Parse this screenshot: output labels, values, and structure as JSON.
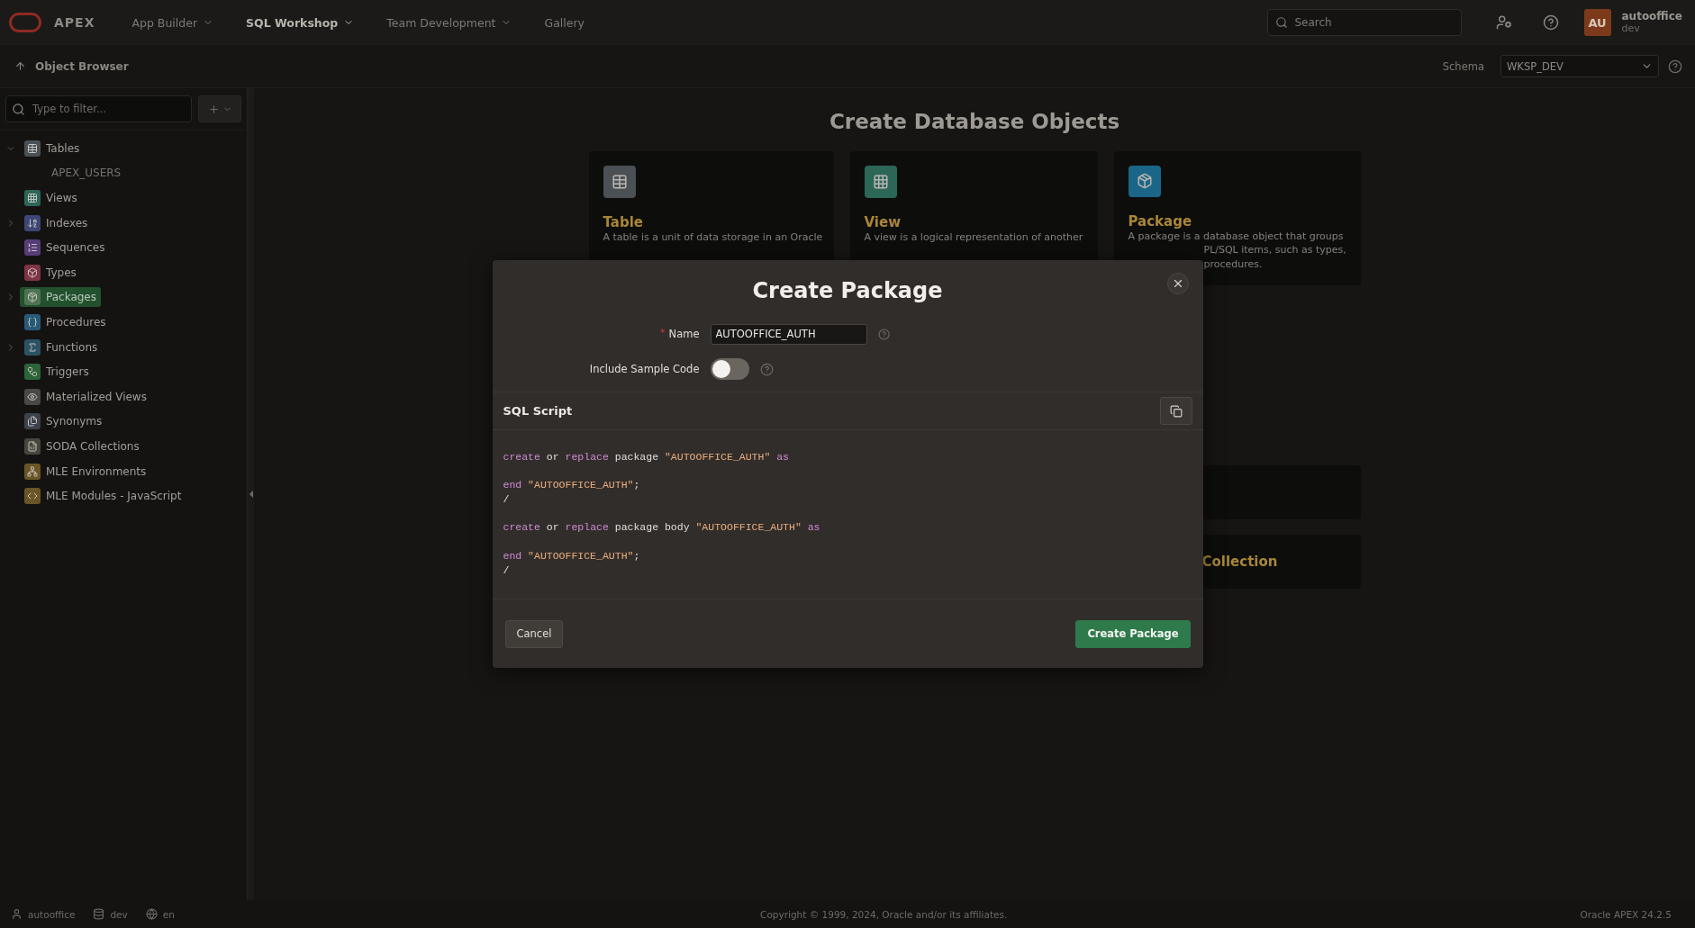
{
  "top_bar": {
    "brand": "APEX",
    "nav": [
      {
        "label": "App Builder",
        "selected": false,
        "dropdown": true
      },
      {
        "label": "SQL Workshop",
        "selected": true,
        "dropdown": true
      },
      {
        "label": "Team Development",
        "selected": false,
        "dropdown": true
      },
      {
        "label": "Gallery",
        "selected": false,
        "dropdown": false
      }
    ],
    "search": {
      "placeholder": "Search"
    },
    "user": {
      "initials": "AU",
      "name": "autooffice",
      "workspace": "dev"
    }
  },
  "sub_bar": {
    "title": "Object Browser",
    "schema_label": "Schema",
    "schema_value": "WKSP_DEV"
  },
  "sidebar": {
    "filter": {
      "placeholder": "Type to filter..."
    },
    "items": [
      {
        "label": "Tables",
        "kind": "branch",
        "expanded": true,
        "selected": false,
        "color": "#4b5054",
        "children": [
          {
            "label": "APEX_USERS",
            "selected": false
          }
        ]
      },
      {
        "label": "Views",
        "kind": "leaf",
        "selected": false,
        "color": "#2c6657"
      },
      {
        "label": "Indexes",
        "kind": "branch",
        "expanded": false,
        "selected": false,
        "color": "#3d4677"
      },
      {
        "label": "Sequences",
        "kind": "leaf",
        "selected": false,
        "color": "#573d78"
      },
      {
        "label": "Types",
        "kind": "leaf",
        "selected": false,
        "color": "#7d3444"
      },
      {
        "label": "Packages",
        "kind": "branch",
        "expanded": false,
        "selected": true,
        "color": "#4f7352"
      },
      {
        "label": "Procedures",
        "kind": "leaf",
        "selected": false,
        "color": "#285a78"
      },
      {
        "label": "Functions",
        "kind": "branch",
        "expanded": false,
        "selected": false,
        "color": "#2b5264"
      },
      {
        "label": "Triggers",
        "kind": "leaf",
        "selected": false,
        "color": "#2b6438"
      },
      {
        "label": "Materialized Views",
        "kind": "leaf",
        "selected": false,
        "color": "#484848"
      },
      {
        "label": "Synonyms",
        "kind": "leaf",
        "selected": false,
        "color": "#3c414b"
      },
      {
        "label": "SODA Collections",
        "kind": "leaf",
        "selected": false,
        "color": "#47463c"
      },
      {
        "label": "MLE Environments",
        "kind": "leaf",
        "selected": false,
        "color": "#6a5526"
      },
      {
        "label": "MLE Modules - JavaScript",
        "kind": "leaf",
        "selected": false,
        "color": "#6a5526"
      }
    ]
  },
  "main": {
    "title": "Create Database Objects",
    "cards": [
      {
        "title": "Table",
        "color": "#4b5054",
        "lines": [
          "A table is a unit of data storage in an Oracle"
        ]
      },
      {
        "title": "View",
        "color": "#2c6657",
        "lines": [
          "A view is a logical representation of another"
        ]
      },
      {
        "title": "Package",
        "color": "#1b6688",
        "lines": [
          "A package is a database object that groups"
        ],
        "partial_lines": [
          "PL/SQL items, such as types,",
          "procedures."
        ]
      }
    ],
    "more_cards": [
      {
        "kind": "blank"
      },
      {
        "kind": "titled",
        "title": "Collection"
      }
    ]
  },
  "dialog": {
    "title": "Create Package",
    "fields": [
      {
        "label": "Name",
        "required_mark": "*",
        "kind": "text",
        "value": "AUTOOFFICE_AUTH"
      },
      {
        "label": "Include Sample Code",
        "kind": "switch",
        "on": false
      }
    ],
    "section_title": "SQL Script",
    "code": [
      {
        "kind": "code",
        "tokens": [
          {
            "kind": "keyword",
            "text": "create"
          },
          {
            "kind": "plain",
            "text": " or "
          },
          {
            "kind": "keyword",
            "text": "replace"
          },
          {
            "kind": "plain",
            "text": " package "
          },
          {
            "kind": "string",
            "text": "\"AUTOOFFICE_AUTH\" "
          },
          {
            "kind": "keyword",
            "text": "as"
          }
        ]
      },
      {
        "kind": "blank"
      },
      {
        "kind": "code",
        "tokens": [
          {
            "kind": "keyword",
            "text": "end "
          },
          {
            "kind": "string",
            "text": "\"AUTOOFFICE_AUTH\""
          },
          {
            "kind": "plain",
            "text": ";"
          }
        ]
      },
      {
        "kind": "code",
        "tokens": [
          {
            "kind": "plain",
            "text": "/"
          }
        ]
      },
      {
        "kind": "blank"
      },
      {
        "kind": "code",
        "tokens": [
          {
            "kind": "keyword",
            "text": "create"
          },
          {
            "kind": "plain",
            "text": " or "
          },
          {
            "kind": "keyword",
            "text": "replace"
          },
          {
            "kind": "plain",
            "text": " package body "
          },
          {
            "kind": "string",
            "text": "\"AUTOOFFICE_AUTH\" "
          },
          {
            "kind": "keyword",
            "text": "as"
          }
        ]
      },
      {
        "kind": "blank"
      },
      {
        "kind": "code",
        "tokens": [
          {
            "kind": "keyword",
            "text": "end "
          },
          {
            "kind": "string",
            "text": "\"AUTOOFFICE_AUTH\""
          },
          {
            "kind": "plain",
            "text": ";"
          }
        ]
      },
      {
        "kind": "code",
        "tokens": [
          {
            "kind": "plain",
            "text": "/"
          }
        ]
      }
    ],
    "buttons": [
      {
        "label": "Cancel",
        "kind": "secondary"
      },
      {
        "label": "Create Package",
        "kind": "primary"
      }
    ]
  },
  "footer": {
    "user": "autooffice",
    "workspace": "dev",
    "language": "en",
    "copyright": "Copyright © 1999, 2024, Oracle and/or its affiliates.",
    "version": "Oracle APEX 24.2.5"
  }
}
